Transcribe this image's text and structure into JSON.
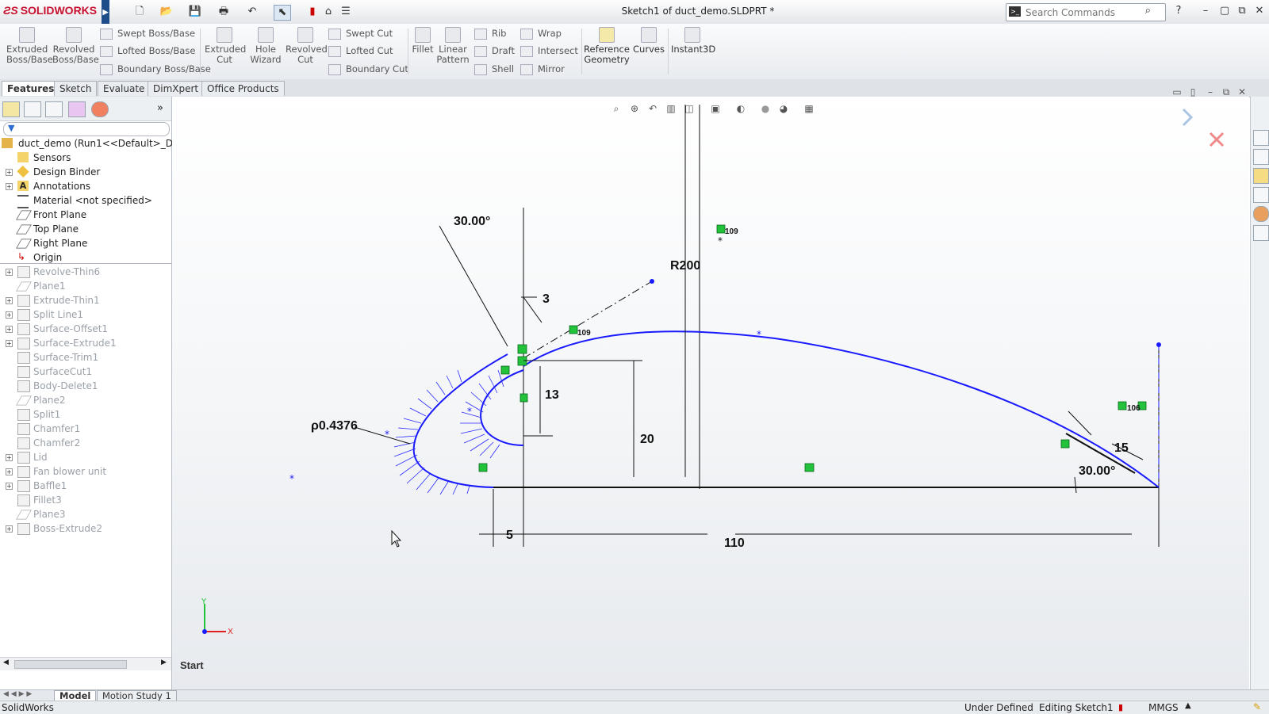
{
  "app": {
    "brand": "SOLIDWORKS",
    "document_title": "Sketch1 of duct_demo.SLDPRT *"
  },
  "search": {
    "placeholder": "Search Commands"
  },
  "toolbar": {
    "extruded_boss": "Extruded Boss/Base",
    "revolved_boss": "Revolved Boss/Base",
    "swept_boss": "Swept Boss/Base",
    "lofted_boss": "Lofted Boss/Base",
    "boundary_boss": "Boundary Boss/Base",
    "extruded_cut": "Extruded Cut",
    "hole_wizard": "Hole Wizard",
    "revolved_cut": "Revolved Cut",
    "swept_cut": "Swept Cut",
    "lofted_cut": "Lofted Cut",
    "boundary_cut": "Boundary Cut",
    "fillet": "Fillet",
    "linear_pattern": "Linear Pattern",
    "rib": "Rib",
    "draft": "Draft",
    "shell": "Shell",
    "wrap": "Wrap",
    "intersect": "Intersect",
    "mirror": "Mirror",
    "reference_geometry": "Reference Geometry",
    "curves": "Curves",
    "instant3d": "Instant3D"
  },
  "tabs": [
    "Features",
    "Sketch",
    "Evaluate",
    "DimXpert",
    "Office Products"
  ],
  "tree": {
    "root": "duct_demo  (Run1<<Default>_Displ",
    "items": [
      "Sensors",
      "Design Binder",
      "Annotations",
      "Material <not specified>",
      "Front Plane",
      "Top Plane",
      "Right Plane",
      "Origin"
    ],
    "features": [
      "Revolve-Thin6",
      "Plane1",
      "Extrude-Thin1",
      "Split Line1",
      "Surface-Offset1",
      "Surface-Extrude1",
      "Surface-Trim1",
      "SurfaceCut1",
      "Body-Delete1",
      "Plane2",
      "Split1",
      "Chamfer1",
      "Chamfer2",
      "Lid",
      "Fan blower unit",
      "Baffle1",
      "Fillet3",
      "Plane3",
      "Boss-Extrude2"
    ]
  },
  "sketch": {
    "angle_top": "30.00°",
    "dim_3": "3",
    "radius": "R200",
    "rel_109a": "109",
    "rel_109b": "109",
    "rel_106": "106",
    "dim_13": "13",
    "dim_20": "20",
    "curvature": "ρ0.4376",
    "dim_15": "15",
    "angle_right": "30.00°",
    "dim_5": "5",
    "dim_110": "110",
    "axis_x": "X",
    "axis_y": "Y"
  },
  "graphics": {
    "start_label": "Start"
  },
  "model_tabs": [
    "Model",
    "Motion Study 1"
  ],
  "status": {
    "app": "SolidWorks",
    "definition": "Under Defined",
    "mode": "Editing Sketch1",
    "units": "MMGS"
  },
  "colors": {
    "sketch_blue": "#1a1aff",
    "relation_green": "#22c23a",
    "brand_red": "#c8102e"
  }
}
